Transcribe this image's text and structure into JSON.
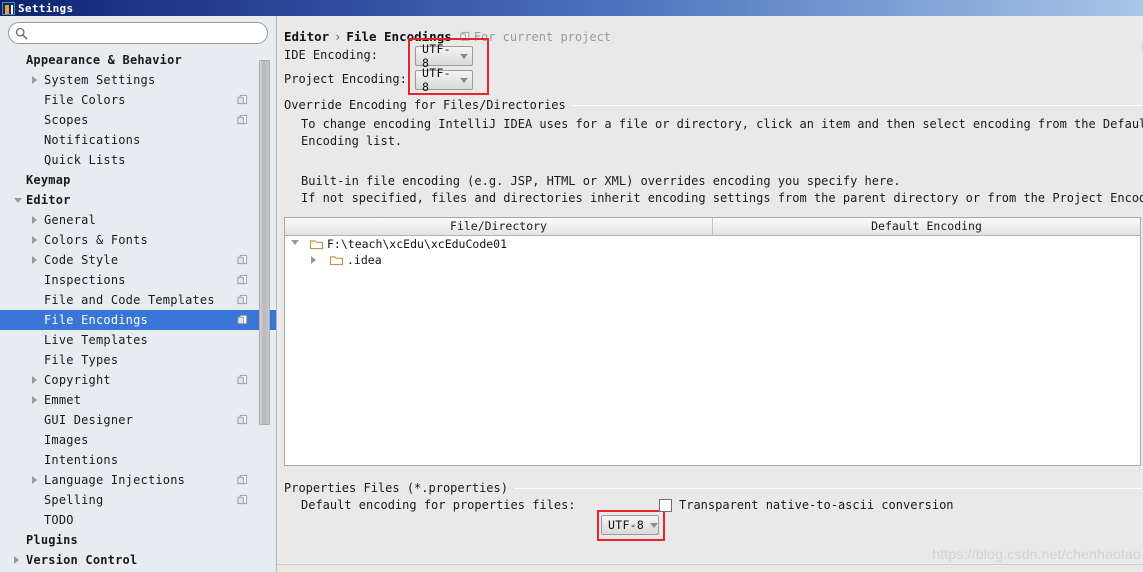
{
  "window": {
    "title": "Settings",
    "logo_icon": "intellij-idea-logo"
  },
  "sidebar": {
    "search": {
      "value": "",
      "placeholder": "",
      "icon": "search-icon"
    },
    "items": [
      {
        "label": "Appearance & Behavior",
        "level": 0,
        "bold": true,
        "arrow": "none",
        "badge": false,
        "selected": false
      },
      {
        "label": "System Settings",
        "level": 1,
        "bold": false,
        "arrow": "right",
        "badge": false,
        "selected": false
      },
      {
        "label": "File Colors",
        "level": 1,
        "bold": false,
        "arrow": "none",
        "badge": true,
        "selected": false
      },
      {
        "label": "Scopes",
        "level": 1,
        "bold": false,
        "arrow": "none",
        "badge": true,
        "selected": false
      },
      {
        "label": "Notifications",
        "level": 1,
        "bold": false,
        "arrow": "none",
        "badge": false,
        "selected": false
      },
      {
        "label": "Quick Lists",
        "level": 1,
        "bold": false,
        "arrow": "none",
        "badge": false,
        "selected": false
      },
      {
        "label": "Keymap",
        "level": 0,
        "bold": true,
        "arrow": "none",
        "badge": false,
        "selected": false
      },
      {
        "label": "Editor",
        "level": 0,
        "bold": true,
        "arrow": "down",
        "badge": false,
        "selected": false
      },
      {
        "label": "General",
        "level": 1,
        "bold": false,
        "arrow": "right",
        "badge": false,
        "selected": false
      },
      {
        "label": "Colors & Fonts",
        "level": 1,
        "bold": false,
        "arrow": "right",
        "badge": false,
        "selected": false
      },
      {
        "label": "Code Style",
        "level": 1,
        "bold": false,
        "arrow": "right",
        "badge": true,
        "selected": false
      },
      {
        "label": "Inspections",
        "level": 1,
        "bold": false,
        "arrow": "none",
        "badge": true,
        "selected": false
      },
      {
        "label": "File and Code Templates",
        "level": 1,
        "bold": false,
        "arrow": "none",
        "badge": true,
        "selected": false
      },
      {
        "label": "File Encodings",
        "level": 1,
        "bold": false,
        "arrow": "none",
        "badge": true,
        "selected": true
      },
      {
        "label": "Live Templates",
        "level": 1,
        "bold": false,
        "arrow": "none",
        "badge": false,
        "selected": false
      },
      {
        "label": "File Types",
        "level": 1,
        "bold": false,
        "arrow": "none",
        "badge": false,
        "selected": false
      },
      {
        "label": "Copyright",
        "level": 1,
        "bold": false,
        "arrow": "right",
        "badge": true,
        "selected": false
      },
      {
        "label": "Emmet",
        "level": 1,
        "bold": false,
        "arrow": "right",
        "badge": false,
        "selected": false
      },
      {
        "label": "GUI Designer",
        "level": 1,
        "bold": false,
        "arrow": "none",
        "badge": true,
        "selected": false
      },
      {
        "label": "Images",
        "level": 1,
        "bold": false,
        "arrow": "none",
        "badge": false,
        "selected": false
      },
      {
        "label": "Intentions",
        "level": 1,
        "bold": false,
        "arrow": "none",
        "badge": false,
        "selected": false
      },
      {
        "label": "Language Injections",
        "level": 1,
        "bold": false,
        "arrow": "right",
        "badge": true,
        "selected": false
      },
      {
        "label": "Spelling",
        "level": 1,
        "bold": false,
        "arrow": "none",
        "badge": true,
        "selected": false
      },
      {
        "label": "TODO",
        "level": 1,
        "bold": false,
        "arrow": "none",
        "badge": false,
        "selected": false
      },
      {
        "label": "Plugins",
        "level": 0,
        "bold": true,
        "arrow": "none",
        "badge": false,
        "selected": false
      },
      {
        "label": "Version Control",
        "level": 0,
        "bold": true,
        "arrow": "right",
        "badge": false,
        "selected": false
      }
    ]
  },
  "main": {
    "breadcrumb": {
      "parent": "Editor",
      "separator": "›",
      "current": "File Encodings",
      "scope_icon": "project-scope-icon",
      "scope_text": "For current project"
    },
    "ide_encoding": {
      "label": "IDE Encoding:",
      "value": "UTF-8"
    },
    "project_encoding": {
      "label": "Project Encoding:",
      "value": "UTF-8"
    },
    "override_group": {
      "title": "Override Encoding for Files/Directories",
      "paragraph1_line1": "To change encoding IntelliJ IDEA uses for a file or directory, click an item and then select encoding from the Default",
      "paragraph1_line2": "Encoding list.",
      "paragraph2_line1": "Built-in file encoding (e.g. JSP, HTML or XML) overrides encoding you specify here.",
      "paragraph2_line2": "If not specified, files and directories inherit encoding settings from the parent directory or from the Project Encoding"
    },
    "table": {
      "columns": [
        "File/Directory",
        "Default Encoding"
      ],
      "rows": [
        {
          "name": "F:\\teach\\xcEdu\\xcEduCode01",
          "encoding": "",
          "depth": 0,
          "arrow": "down",
          "icon": "folder-icon"
        },
        {
          "name": ".idea",
          "encoding": "",
          "depth": 1,
          "arrow": "right",
          "icon": "folder-icon"
        }
      ]
    },
    "properties_group": {
      "title": "Properties Files (*.properties)",
      "default_encoding_label": "Default encoding for properties files:",
      "default_encoding_value": "UTF-8",
      "transparent_checkbox_label": "Transparent native-to-ascii conversion",
      "transparent_checkbox_checked": false
    },
    "reset_link_clipped": "R",
    "watermark": "https://blog.csdn.net/chenhaotao"
  },
  "colors": {
    "selection_blue": "#3875d7",
    "annotation_red": "#e8232a",
    "title_bar_dark": "#0a246a",
    "title_bar_light": "#a8c6e8",
    "sidebar_bg": "#e7ecf0",
    "panel_bg": "#e9e9e9"
  }
}
